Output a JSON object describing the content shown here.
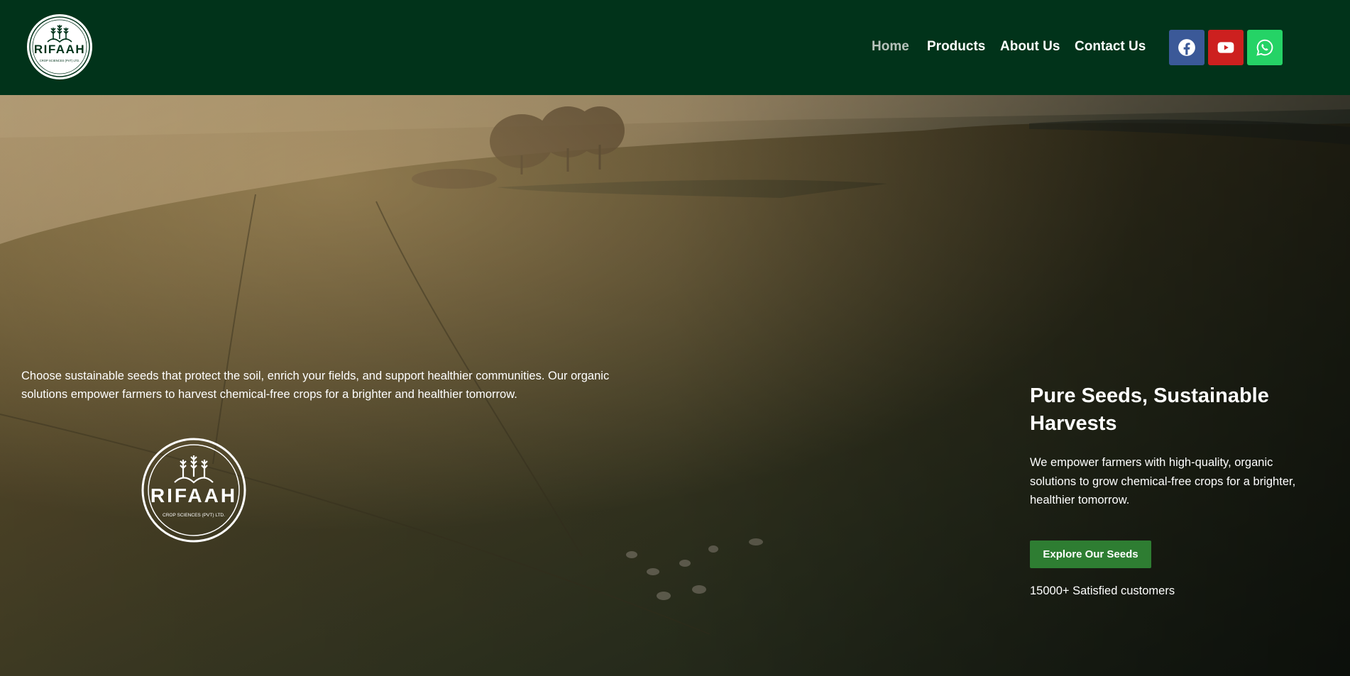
{
  "brand": {
    "name": "RIFAAH",
    "logo_subtext": "CROP SCIENCES (PVT) LTD."
  },
  "nav": {
    "items": [
      {
        "label": "Home",
        "active": true
      },
      {
        "label": "Products",
        "active": false
      },
      {
        "label": "About Us",
        "active": false
      },
      {
        "label": "Contact Us",
        "active": false
      }
    ]
  },
  "social": [
    {
      "icon": "facebook-icon",
      "color": "#3b5998"
    },
    {
      "icon": "youtube-icon",
      "color": "#cd201f"
    },
    {
      "icon": "whatsapp-icon",
      "color": "#25d366"
    }
  ],
  "hero": {
    "left_text": "Choose sustainable seeds that protect the soil, enrich your fields, and support healthier communities. Our organic solutions empower farmers to harvest chemical-free crops for a brighter and healthier tomorrow.",
    "title": "Pure Seeds, Sustainable Harvests",
    "description": "We empower farmers with high-quality, organic solutions to grow chemical-free crops for a brighter, healthier tomorrow.",
    "cta_label": "Explore Our Seeds",
    "customers": "15000+ Satisfied customers"
  },
  "colors": {
    "header_bg": "#01331a",
    "cta_bg": "#2e7d32"
  }
}
